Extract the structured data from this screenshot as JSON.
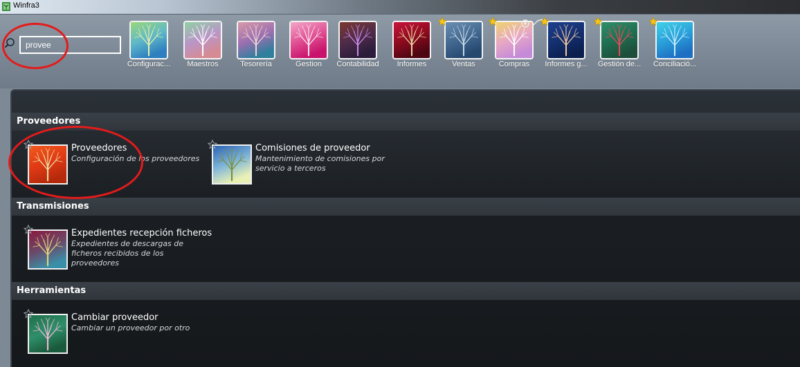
{
  "window": {
    "title": "Winfra3"
  },
  "search": {
    "value": "provee"
  },
  "modules": [
    {
      "label": "Configurac...",
      "favorite": false,
      "colors": [
        "#9ad87c",
        "#5fb7c9",
        "#2d7fbf"
      ],
      "tree": "#e6f1a8"
    },
    {
      "label": "Maestros",
      "favorite": false,
      "colors": [
        "#8fd1a3",
        "#b996c8",
        "#d58a94"
      ],
      "tree": "#ffffff"
    },
    {
      "label": "Tesorería",
      "favorite": false,
      "colors": [
        "#d89aa8",
        "#9b6fb0",
        "#2f7f9d"
      ],
      "tree": "#f2d5d5"
    },
    {
      "label": "Gestion",
      "favorite": false,
      "colors": [
        "#f2a9c9",
        "#e04f93",
        "#c8126b"
      ],
      "tree": "#fbe5ef"
    },
    {
      "label": "Contabilidad",
      "favorite": false,
      "colors": [
        "#7a3b2f",
        "#4f2b4a",
        "#2a1c3a"
      ],
      "tree": "#c98ae8"
    },
    {
      "label": "Informes",
      "favorite": false,
      "colors": [
        "#c9153c",
        "#8d0b1f",
        "#4d0512"
      ],
      "tree": "#e8d5a0"
    },
    {
      "label": "Ventas",
      "favorite": true,
      "colors": [
        "#6b8fb3",
        "#43688f",
        "#25486f"
      ],
      "tree": "#c6d8ea"
    },
    {
      "label": "Compras",
      "favorite": true,
      "colors": [
        "#f0d36e",
        "#e7a7c5",
        "#c58bd7"
      ],
      "tree": "#ffffff"
    },
    {
      "label": "Informes g...",
      "favorite": true,
      "colors": [
        "#1e3f8f",
        "#14306f",
        "#0b1f4f"
      ],
      "tree": "#f4c6a3"
    },
    {
      "label": "Gestión de...",
      "favorite": true,
      "colors": [
        "#2f8f6a",
        "#1f6f52",
        "#1d4f3a"
      ],
      "tree": "#e64a5a"
    },
    {
      "label": "Conciliació...",
      "favorite": true,
      "colors": [
        "#3fd2e9",
        "#2a9fd9",
        "#1e6fc3"
      ],
      "tree": "#c6f0ff"
    }
  ],
  "sections": [
    {
      "title": "Proveedores",
      "items": [
        {
          "name": "Proveedores",
          "desc": "Configuración de los proveedores",
          "colors": [
            "#f25a1e",
            "#e03a15",
            "#b52a0b"
          ],
          "tree": "#e9e0a2"
        },
        {
          "name": "Comisiones de proveedor",
          "desc": "Mantenimiento de comisiones por servicio a terceros",
          "colors": [
            "#2b63b5",
            "#7fb5d9",
            "#e9f0b5"
          ],
          "tree": "#7a8f3a"
        }
      ]
    },
    {
      "title": "Transmisiones",
      "items": [
        {
          "name": "Expedientes recepción ficheros",
          "desc": "Expedientes de descargas de ficheros recibidos de los proveedores",
          "colors": [
            "#8b1a3f",
            "#6a4a6a",
            "#3a8fa8"
          ],
          "tree": "#e8d27a"
        }
      ]
    },
    {
      "title": "Herramientas",
      "items": [
        {
          "name": "Cambiar proveedor",
          "desc": "Cambiar un proveedor por otro",
          "colors": [
            "#1f6f4a",
            "#2f8f6a",
            "#1a5a3c"
          ],
          "tree": "#f4b8d8"
        }
      ]
    }
  ],
  "colors": {
    "annotation": "#e41b1b",
    "star": "#f5c518"
  }
}
